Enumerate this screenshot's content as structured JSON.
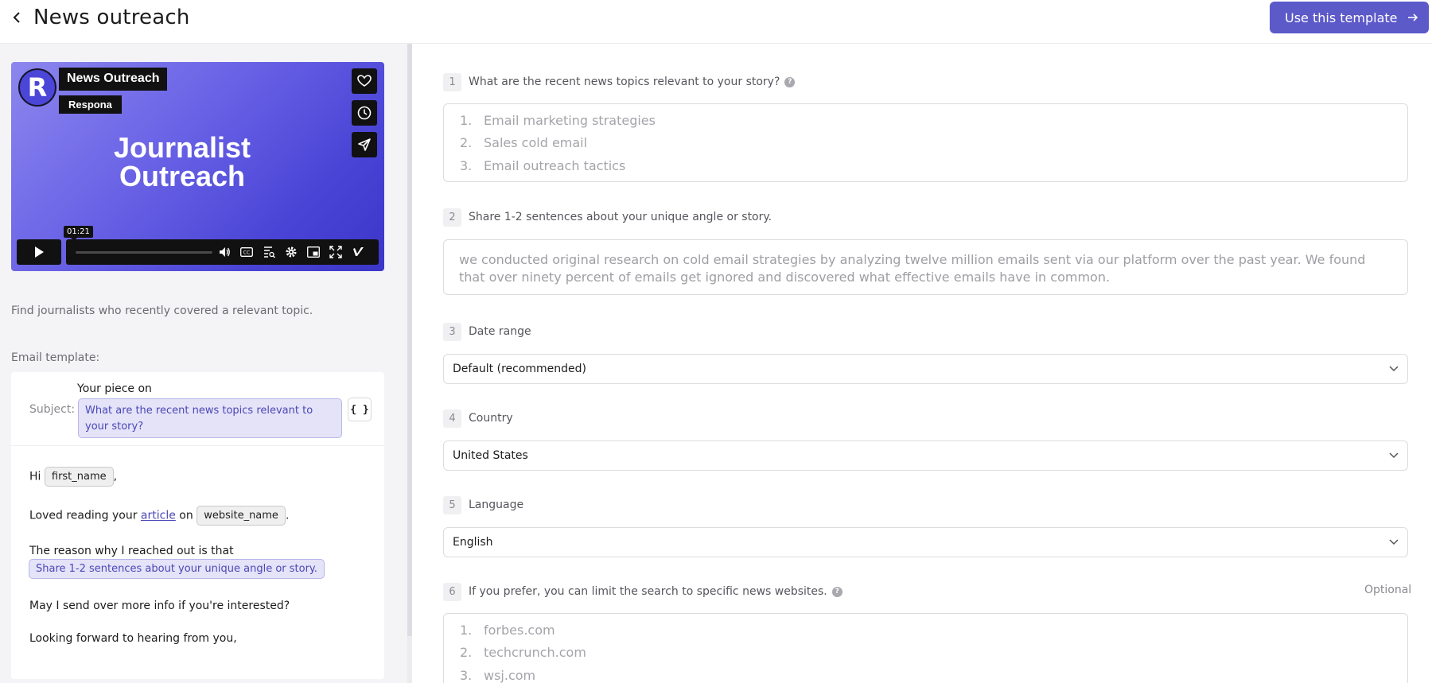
{
  "header": {
    "title": "News outreach",
    "use_template_label": "Use this template"
  },
  "video": {
    "title": "News Outreach",
    "author": "Respona",
    "logo_letter": "R",
    "headline": "Journalist Outreach",
    "timestamp": "01:21"
  },
  "left": {
    "description": "Find journalists who recently covered a relevant topic.",
    "template_label": "Email template:",
    "subject_label": "Subject:",
    "subject_prefix": "Your piece on",
    "subject_variable": "What are the recent news topics relevant to your story?",
    "variables_button": "{ }",
    "body": {
      "greeting": "Hi",
      "first_name_var": "first_name",
      "loved_reading": "Loved reading your",
      "article_link": "article",
      "on_word": "on",
      "website_name_var": "website_name",
      "reason": "The reason why I reached out is that",
      "angle_var": "Share 1-2 sentences about your unique angle or story.",
      "send_info": "May I send over more info if you're interested?",
      "closing": "Looking forward to hearing from you,"
    }
  },
  "form": {
    "q1": {
      "num": "1",
      "label": "What are the recent news topics relevant to your story?",
      "placeholders": [
        {
          "num": "1.",
          "text": "Email marketing strategies"
        },
        {
          "num": "2.",
          "text": "Sales cold email"
        },
        {
          "num": "3.",
          "text": "Email outreach tactics"
        }
      ]
    },
    "q2": {
      "num": "2",
      "label": "Share 1-2 sentences about your unique angle or story.",
      "placeholder": "we conducted original research on cold email strategies by analyzing twelve million emails sent via our platform over the past year. We found that over ninety percent of emails get ignored and discovered what effective emails have in common."
    },
    "q3": {
      "num": "3",
      "label": "Date range",
      "value": "Default (recommended)"
    },
    "q4": {
      "num": "4",
      "label": "Country",
      "value": "United States"
    },
    "q5": {
      "num": "5",
      "label": "Language",
      "value": "English"
    },
    "q6": {
      "num": "6",
      "label": "If you prefer, you can limit the search to specific news websites.",
      "optional": "Optional",
      "placeholders": [
        {
          "num": "1.",
          "text": "forbes.com"
        },
        {
          "num": "2.",
          "text": "techcrunch.com"
        },
        {
          "num": "3.",
          "text": "wsj.com"
        }
      ]
    }
  },
  "colors": {
    "accent": "#5c59c9",
    "chip_purple_bg": "#e4e3f8",
    "chip_purple_text": "#4b47b6"
  },
  "icons": [
    "chevron-left-icon",
    "arrow-right-icon",
    "heart-icon",
    "clock-icon",
    "send-icon",
    "play-icon",
    "volume-icon",
    "cc-icon",
    "transcript-icon",
    "settings-icon",
    "pip-icon",
    "fullscreen-icon",
    "vimeo-icon",
    "help-icon",
    "chevron-down-icon"
  ]
}
